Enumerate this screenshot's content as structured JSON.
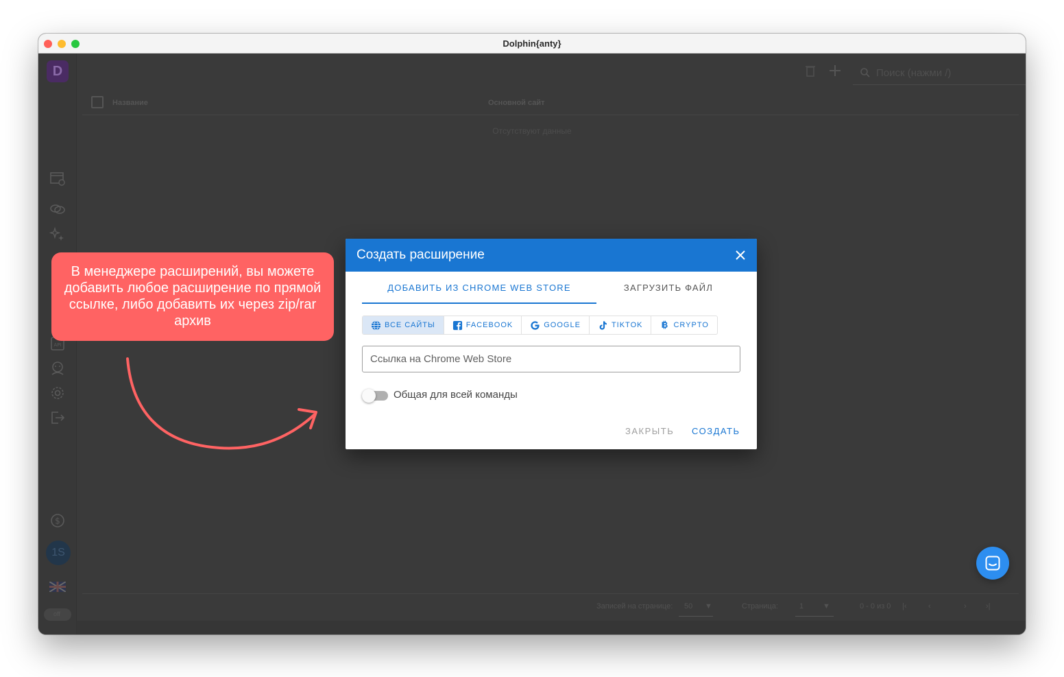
{
  "window": {
    "title": "Dolphin{anty}"
  },
  "sidebar": {
    "logo": "D",
    "avatar_initials": "1S",
    "toggle_text": "off"
  },
  "topbar": {
    "search_placeholder": "Поиск (нажми /)"
  },
  "table": {
    "columns": [
      "Название",
      "Основной сайт"
    ],
    "empty_text": "Отсутствуют данные"
  },
  "footer": {
    "rows_per_page_label": "Записей на странице:",
    "rows_per_page_value": "50",
    "page_label": "Страница:",
    "page_value": "1",
    "range_text": "0 - 0 из 0"
  },
  "dialog": {
    "title": "Создать расширение",
    "tabs": [
      {
        "label": "ДОБАВИТЬ ИЗ CHROME WEB STORE",
        "active": true
      },
      {
        "label": "ЗАГРУЗИТЬ ФАЙЛ",
        "active": false
      }
    ],
    "filters": [
      {
        "label": "ВСЕ САЙТЫ",
        "icon": "globe-icon",
        "active": true
      },
      {
        "label": "FACEBOOK",
        "icon": "facebook-icon",
        "active": false
      },
      {
        "label": "GOOGLE",
        "icon": "google-icon",
        "active": false
      },
      {
        "label": "TIKTOK",
        "icon": "tiktok-icon",
        "active": false
      },
      {
        "label": "CRYPTO",
        "icon": "bitcoin-icon",
        "active": false
      }
    ],
    "url_placeholder": "Ссылка на Chrome Web Store",
    "url_value": "",
    "share_toggle_label": "Общая для всей команды",
    "share_toggle_on": false,
    "buttons": {
      "close": "ЗАКРЫТЬ",
      "create": "СОЗДАТЬ"
    }
  },
  "annotation": {
    "text": "В менеджере расширений, вы можете добавить любое расширение по прямой ссылке, либо добавить их через zip/rar архив"
  },
  "colors": {
    "primary": "#1976d2",
    "callout": "#ff6363",
    "chat_button": "#2d8ef0",
    "overlay": "#3a3a3a"
  }
}
